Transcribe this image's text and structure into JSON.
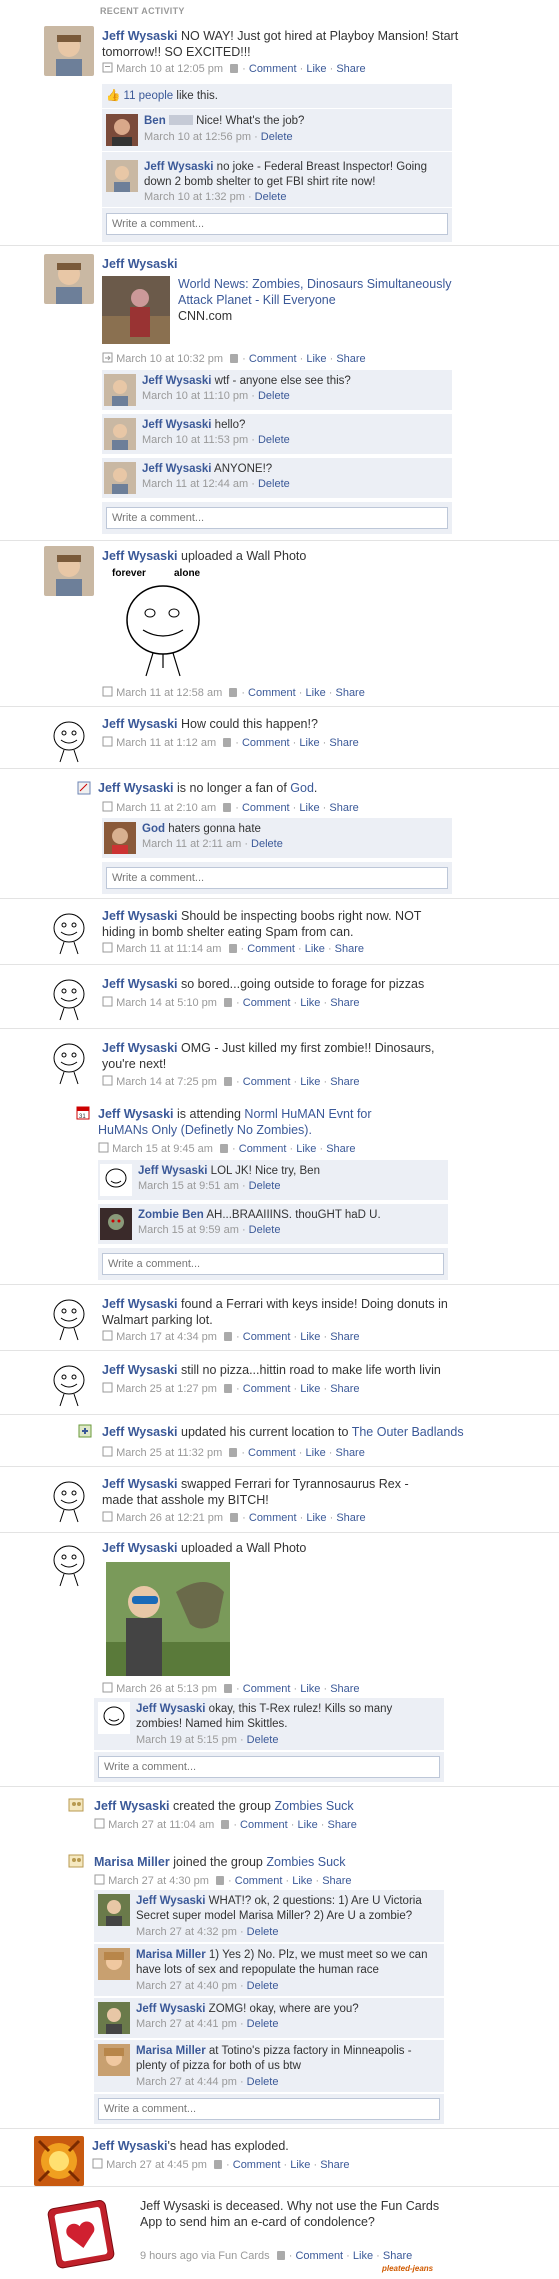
{
  "header": "RECENT ACTIVITY",
  "actions": {
    "comment": "Comment",
    "like": "Like",
    "share": "Share",
    "delete": "Delete",
    "write": "Write a comment..."
  },
  "watermark": "pleated-jeans",
  "s1": {
    "name": "Jeff Wysaski",
    "text": "NO WAY! Just got hired at Playboy Mansion! Start tomorrow!! SO EXCITED!!!",
    "time": "March 10 at 12:05 pm",
    "likes": "11 people",
    "likes_suffix": "like this.",
    "c1": {
      "name": "Ben",
      "text": "Nice! What's the job?",
      "time": "March 10 at 12:56 pm"
    },
    "c2": {
      "name": "Jeff Wysaski",
      "text": "no joke - Federal Breast Inspector! Going down 2 bomb shelter to get FBI shirt rite now!",
      "time": "March 10 at 1:32 pm"
    }
  },
  "s2": {
    "name": "Jeff Wysaski",
    "link_title": "World News: Zombies, Dinosaurs Simultaneously Attack Planet - Kill Everyone",
    "link_src": "CNN.com",
    "time": "March 10 at 10:32 pm",
    "c1": {
      "name": "Jeff Wysaski",
      "text": "wtf - anyone else see this?",
      "time": "March 10 at 11:10 pm"
    },
    "c2": {
      "name": "Jeff Wysaski",
      "text": "hello?",
      "time": "March 10 at 11:53 pm"
    },
    "c3": {
      "name": "Jeff Wysaski",
      "text": "ANYONE!?",
      "time": "March 11 at 12:44 am"
    }
  },
  "s3": {
    "name": "Jeff Wysaski",
    "text": "uploaded a Wall Photo",
    "photo_caption_left": "forever",
    "photo_caption_right": "alone",
    "time": "March 11 at 12:58 am"
  },
  "s4": {
    "name": "Jeff Wysaski",
    "text": "How could this happen!?",
    "time": "March 11 at 1:12 am"
  },
  "s5": {
    "name": "Jeff Wysaski",
    "text": "is no longer a fan of",
    "page": "God",
    "time": "March 11 at 2:10 am",
    "c1": {
      "name": "God",
      "text": "haters gonna hate",
      "time": "March 11 at 2:11 am"
    }
  },
  "s6": {
    "name": "Jeff Wysaski",
    "text": "Should be inspecting boobs right now. NOT hiding in bomb shelter eating Spam from can.",
    "time": "March 11 at 11:14 am"
  },
  "s7": {
    "name": "Jeff Wysaski",
    "text": "so bored...going outside to forage for pizzas",
    "time": "March 14 at 5:10 pm"
  },
  "s8": {
    "name": "Jeff Wysaski",
    "text": "OMG - Just killed my first zombie!! Dinosaurs, you're next!",
    "time": "March 14 at 7:25 pm"
  },
  "s9": {
    "name": "Jeff Wysaski",
    "text": "is attending",
    "event": "Norml HuMAN Evnt for HuMANs Only (Definetly No Zombies).",
    "time": "March 15 at 9:45 am",
    "c1": {
      "name": "Jeff Wysaski",
      "text": "LOL JK! Nice try, Ben",
      "time": "March 15 at 9:51 am"
    },
    "c2": {
      "name": "Zombie Ben",
      "text": "AH...BRAAIIINS. thouGHT haD U.",
      "time": "March 15 at 9:59 am"
    }
  },
  "s10": {
    "name": "Jeff Wysaski",
    "text": "found a Ferrari with keys inside! Doing donuts in Walmart parking lot.",
    "time": "March 17 at 4:34 pm"
  },
  "s11": {
    "name": "Jeff Wysaski",
    "text": "still no pizza...hittin road to make life worth livin",
    "time": "March 25 at 1:27 pm"
  },
  "s12": {
    "name": "Jeff Wysaski",
    "text": "updated his current location to",
    "place": "The Outer Badlands",
    "time": "March 25 at 11:32 pm"
  },
  "s13": {
    "name": "Jeff Wysaski",
    "text": "swapped Ferrari for Tyrannosaurus Rex - made that asshole my BITCH!",
    "time": "March 26 at 12:21 pm"
  },
  "s14": {
    "name": "Jeff Wysaski",
    "text": "uploaded a Wall Photo",
    "time": "March 26 at 5:13 pm",
    "c1": {
      "name": "Jeff Wysaski",
      "text": "okay, this T-Rex rulez! Kills so many zombies! Named him Skittles.",
      "time": "March 19 at 5:15 pm"
    }
  },
  "s15": {
    "name": "Jeff Wysaski",
    "text": "created the group",
    "group": "Zombies Suck",
    "time": "March 27 at 11:04 am"
  },
  "s16": {
    "name": "Marisa Miller",
    "text": "joined the group",
    "group": "Zombies Suck",
    "time": "March 27 at 4:30 pm",
    "c1": {
      "name": "Jeff Wysaski",
      "text": "WHAT!? ok, 2 questions: 1) Are U Victoria Secret super model Marisa Miller? 2) Are U a zombie?",
      "time": "March 27 at 4:32 pm"
    },
    "c2": {
      "name": "Marisa Miller",
      "text": "1) Yes 2) No. Plz, we must meet so we can have lots of sex and repopulate the human race",
      "time": "March 27 at 4:40 pm"
    },
    "c3": {
      "name": "Jeff Wysaski",
      "text": "ZOMG! okay, where are you?",
      "time": "March 27 at 4:41 pm"
    },
    "c4": {
      "name": "Marisa Miller",
      "text": "at Totino's pizza factory in Minneapolis - plenty of pizza for both of us btw",
      "time": "March 27 at 4:44 pm"
    }
  },
  "s17": {
    "name": "Jeff Wysaski",
    "suffix": "'s head has exploded.",
    "time": "March 27 at 4:45 pm"
  },
  "s18": {
    "text": "Jeff Wysaski is deceased. Why not use the Fun Cards App to send him an e-card of condolence?",
    "time": "9 hours ago via Fun Cards"
  }
}
